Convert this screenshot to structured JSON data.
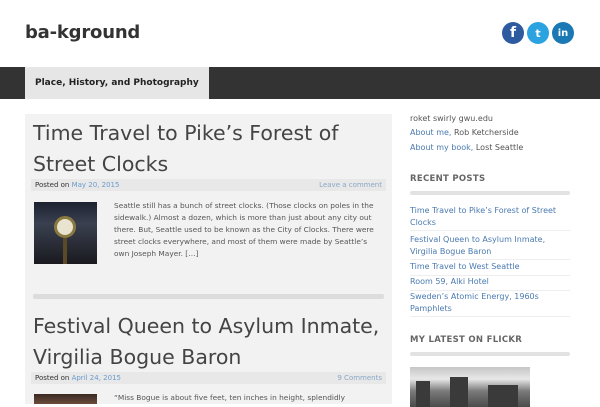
{
  "site": {
    "title": "ba-kground"
  },
  "social": {
    "facebook": "f",
    "twitter": "t",
    "linkedin": "in"
  },
  "nav": {
    "items": [
      "Place, History, and Photography"
    ]
  },
  "posts": [
    {
      "title": "Time Travel to Pike’s Forest of Street Clocks",
      "posted_label": "Posted on",
      "date": "May 20, 2015",
      "comments": "Leave a comment",
      "excerpt": "Seattle still has a bunch of street clocks. (Those clocks on poles in the sidewalk.) Almost a dozen, which is more than just about any city out there. But, Seattle used to be known as the City of Clocks. There were street clocks everywhere, and most of them were made by Seattle’s own Joseph Mayer. […]"
    },
    {
      "title": "Festival Queen to Asylum Inmate, Virgilia Bogue Baron",
      "posted_label": "Posted on",
      "date": "April 24, 2015",
      "comments": "9 Comments",
      "excerpt": "“Miss Bogue is about five feet, ten inches in height, splendidly"
    }
  ],
  "sidebar": {
    "top_lines": [
      {
        "text": "roket swirly gwu.edu",
        "link": ""
      },
      {
        "text": "About me, ",
        "link": "Rob Ketcherside"
      },
      {
        "text": "About my book, ",
        "link": "Lost Seattle"
      }
    ],
    "recent_heading": "RECENT POSTS",
    "recent_posts": [
      "Time Travel to Pike’s Forest of Street Clocks",
      "Festival Queen to Asylum Inmate, Virgilia Bogue Baron",
      "Time Travel to West Seattle",
      "Room 59, Alki Hotel",
      "Sweden’s Atomic Energy, 1960s Pamphlets"
    ],
    "flickr_heading": "MY LATEST ON FLICKR"
  }
}
